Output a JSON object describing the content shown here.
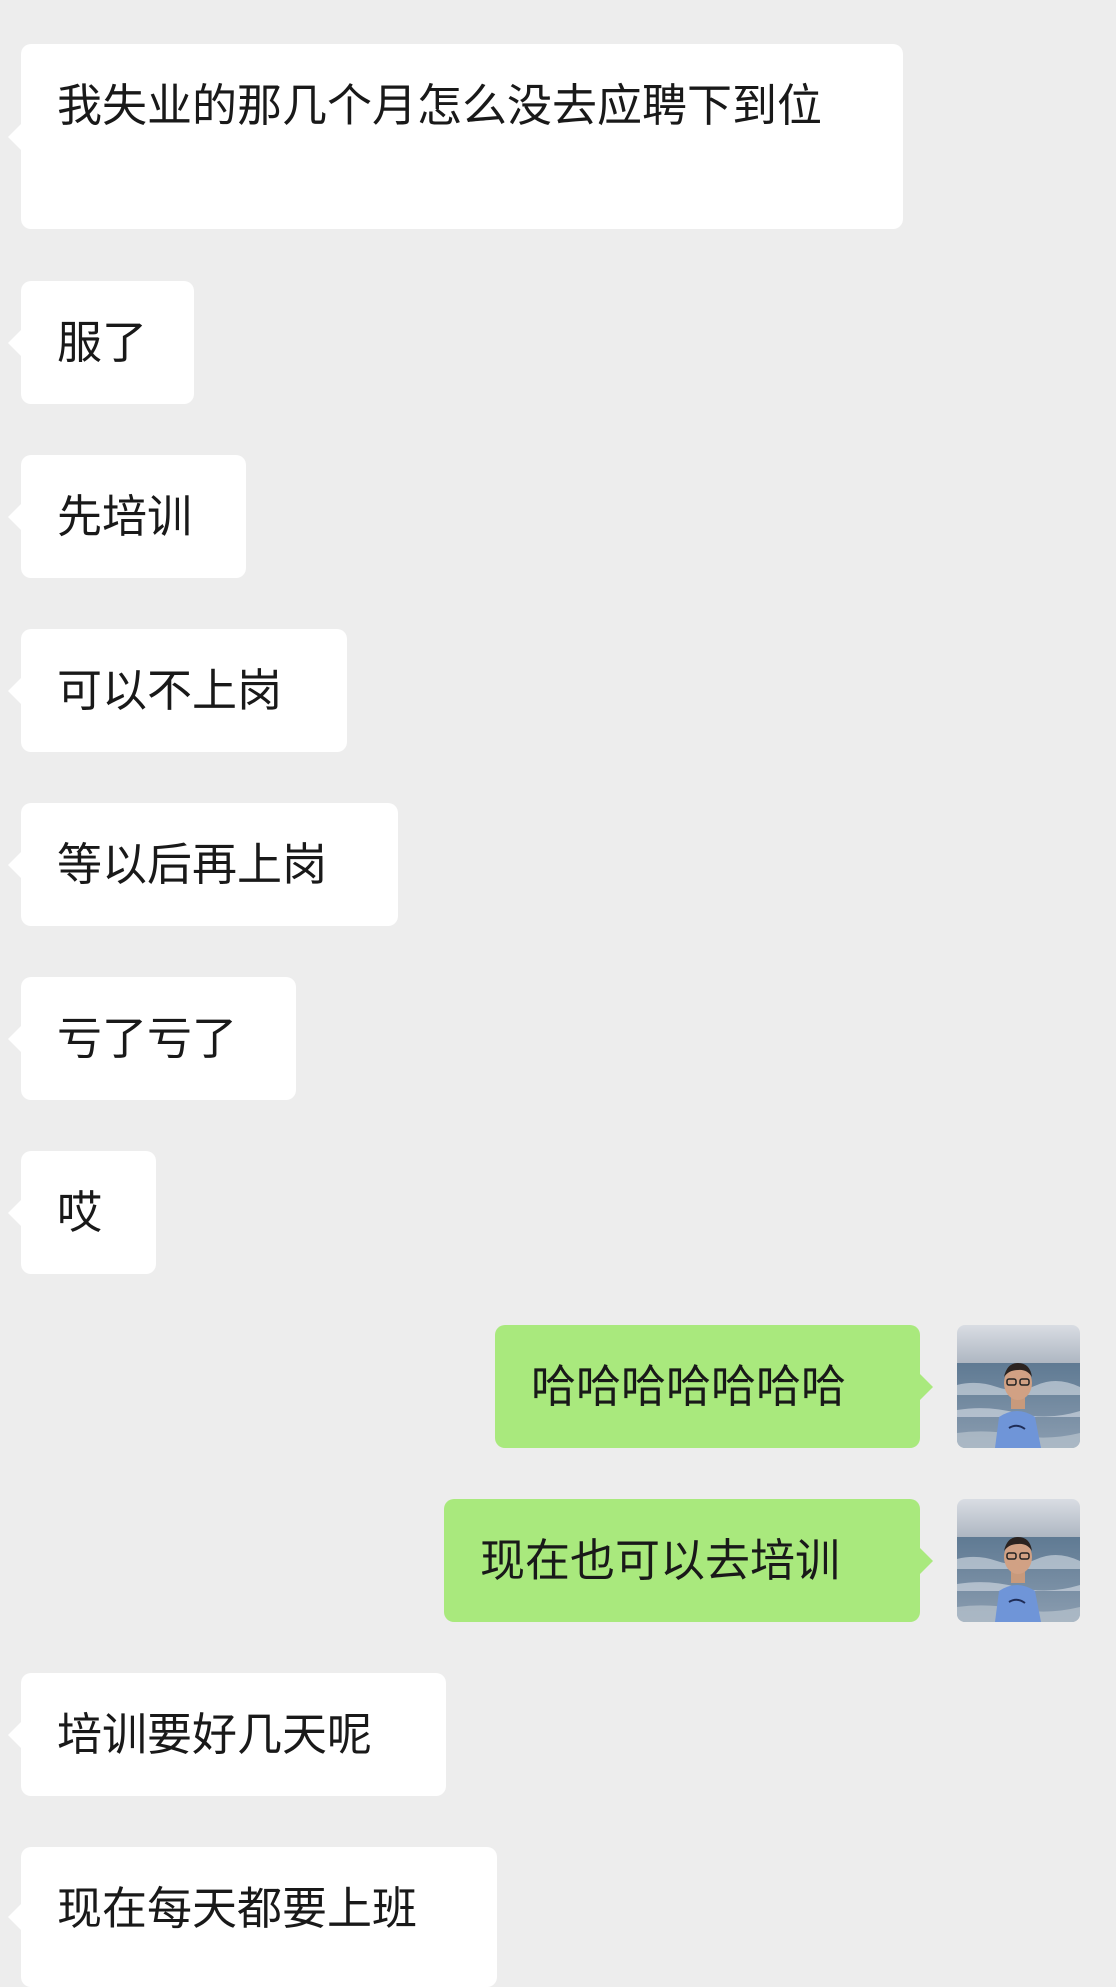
{
  "messages": [
    {
      "side": "in",
      "text": "我失业的那几个月怎么没去应聘下到位"
    },
    {
      "side": "in",
      "text": "服了"
    },
    {
      "side": "in",
      "text": "先培训"
    },
    {
      "side": "in",
      "text": "可以不上岗"
    },
    {
      "side": "in",
      "text": "等以后再上岗"
    },
    {
      "side": "in",
      "text": "亏了亏了"
    },
    {
      "side": "in",
      "text": "哎"
    },
    {
      "side": "out",
      "text": "哈哈哈哈哈哈哈",
      "avatar": "user-avatar-photo"
    },
    {
      "side": "out",
      "text": "现在也可以去培训",
      "avatar": "user-avatar-photo"
    },
    {
      "side": "in",
      "text": "培训要好几天呢"
    },
    {
      "side": "in",
      "text": "现在每天都要上班"
    }
  ],
  "colors": {
    "background": "#ededed",
    "incoming_bubble": "#ffffff",
    "outgoing_bubble": "#a9e97d",
    "text": "#191919"
  }
}
